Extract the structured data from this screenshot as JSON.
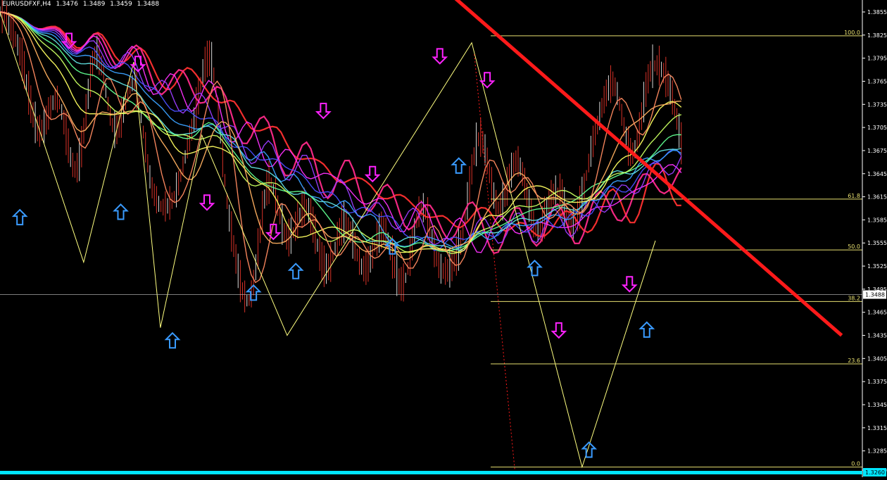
{
  "header": {
    "symbol": "EURUSDFXF,H4",
    "open": "1.3476",
    "high": "1.3489",
    "low": "1.3459",
    "close": "1.3488"
  },
  "colors": {
    "background": "#000000",
    "candle": "#ff3b2f",
    "candle_alt": "#ffffff",
    "fib_line": "#e8e070",
    "trendline": "#ff1a1a",
    "zigzag": "#ffff80",
    "up_arrow": "#3a9bff",
    "down_arrow": "#ff22ff",
    "bottom_bar": "#00e5ff",
    "axis_text": "#ffffff"
  },
  "chart_data": {
    "type": "line",
    "ylim": [
      1.326,
      1.3855
    ],
    "y_ticks": [
      "1.3855",
      "1.3825",
      "1.3795",
      "1.3765",
      "1.3735",
      "1.3705",
      "1.3675",
      "1.3645",
      "1.3615",
      "1.3585",
      "1.3555",
      "1.3525",
      "1.3495",
      "1.3465",
      "1.3435",
      "1.3405",
      "1.3375",
      "1.3345",
      "1.3315",
      "1.3285",
      "1.3260"
    ],
    "current_price": "1.3488",
    "bottom_label": "1.3260",
    "price_path": [
      1.3855,
      1.3805,
      1.37,
      1.374,
      1.365,
      1.38,
      1.37,
      1.376,
      1.362,
      1.361,
      1.37,
      1.379,
      1.358,
      1.348,
      1.363,
      1.356,
      1.36,
      1.352,
      1.358,
      1.352,
      1.357,
      1.35,
      1.36,
      1.352,
      1.355,
      1.369,
      1.36,
      1.366,
      1.357,
      1.362,
      1.358,
      1.369,
      1.376,
      1.367,
      1.378,
      1.375,
      1.362,
      1.352,
      1.354,
      1.342,
      1.33,
      1.34,
      1.338,
      1.348,
      1.344,
      1.349
    ],
    "fibonacci": [
      {
        "label": "100.0",
        "level": 1.3824
      },
      {
        "label": "61.8",
        "level": 1.3612
      },
      {
        "label": "50.0",
        "level": 1.3546
      },
      {
        "label": "38.2",
        "level": 1.3479
      },
      {
        "label": "23.6",
        "level": 1.3398
      },
      {
        "label": "0.0",
        "level": 1.3264
      }
    ],
    "horizontal_line": 1.3488,
    "zigzag": [
      [
        0,
        1.3855
      ],
      [
        0.097,
        1.353
      ],
      [
        0.155,
        1.379
      ],
      [
        0.186,
        1.3445
      ],
      [
        0.234,
        1.3695
      ],
      [
        0.333,
        1.3435
      ],
      [
        0.547,
        1.3815
      ],
      [
        0.675,
        1.3264
      ],
      [
        0.76,
        1.3558
      ]
    ],
    "trendline": [
      [
        0.5,
        1.39
      ],
      [
        0.976,
        1.3435
      ]
    ],
    "dotted_line": [
      [
        0.55,
        1.38
      ],
      [
        0.597,
        1.326
      ]
    ],
    "up_arrows": [
      [
        0.023,
        1.3588
      ],
      [
        0.14,
        1.3595
      ],
      [
        0.2,
        1.3428
      ],
      [
        0.294,
        1.349
      ],
      [
        0.343,
        1.3518
      ],
      [
        0.455,
        1.355
      ],
      [
        0.532,
        1.3655
      ],
      [
        0.62,
        1.3522
      ],
      [
        0.683,
        1.3286
      ],
      [
        0.75,
        1.3442
      ]
    ],
    "down_arrows": [
      [
        0.08,
        1.3818
      ],
      [
        0.16,
        1.3788
      ],
      [
        0.24,
        1.3608
      ],
      [
        0.317,
        1.357
      ],
      [
        0.375,
        1.3727
      ],
      [
        0.432,
        1.3645
      ],
      [
        0.51,
        1.3798
      ],
      [
        0.565,
        1.3767
      ],
      [
        0.648,
        1.3442
      ],
      [
        0.73,
        1.3502
      ]
    ],
    "ribbon_colors": [
      "#ff3030",
      "#ff2a8a",
      "#ff30ff",
      "#9a3cff",
      "#4a50ff",
      "#3aa0ff",
      "#60e0e0",
      "#60ff90",
      "#c8ff60",
      "#ffff60",
      "#ffb060",
      "#ff8a60"
    ]
  }
}
